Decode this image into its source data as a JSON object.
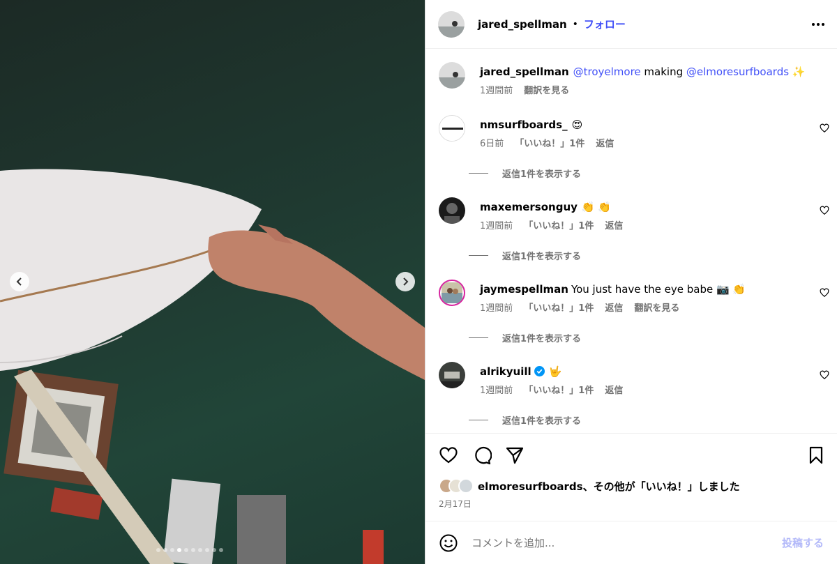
{
  "header": {
    "username": "jared_spellman",
    "separator": "•",
    "follow_label": "フォロー"
  },
  "caption": {
    "username": "jared_spellman",
    "mention1": "@troyelmore",
    "text_mid": " making ",
    "mention2": "@elmoresurfboards",
    "emoji": "✨",
    "time": "1週間前",
    "translate": "翻訳を見る"
  },
  "comments": [
    {
      "username": "nmsurfboards_",
      "text": "😍",
      "time": "6日前",
      "likes": "「いいね！」1件",
      "reply": "返信",
      "view_replies": "返信1件を表示する"
    },
    {
      "username": "maxemersonguy",
      "text": "👏 👏",
      "time": "1週間前",
      "likes": "「いいね！」1件",
      "reply": "返信",
      "view_replies": "返信1件を表示する"
    },
    {
      "username": "jaymespellman",
      "text": "You just have the eye babe 📷 👏",
      "time": "1週間前",
      "likes": "「いいね！」1件",
      "reply": "返信",
      "translate": "翻訳を見る",
      "view_replies": "返信1件を表示する"
    },
    {
      "username": "alrikyuill",
      "verified": true,
      "text": "🤟",
      "time": "1週間前",
      "likes": "「いいね！」1件",
      "reply": "返信",
      "view_replies": "返信1件を表示する"
    }
  ],
  "actions": {
    "likes_text": "elmoresurfboards、その他が「いいね！」しました",
    "date": "2月17日"
  },
  "comment_box": {
    "placeholder": "コメントを追加...",
    "post_label": "投稿する"
  },
  "carousel": {
    "total_slides": 10,
    "active_index": 3
  },
  "colors": {
    "link": "#4150f7",
    "muted": "#737373",
    "post_disabled": "#b3b9f9",
    "verified": "#0095f6"
  }
}
